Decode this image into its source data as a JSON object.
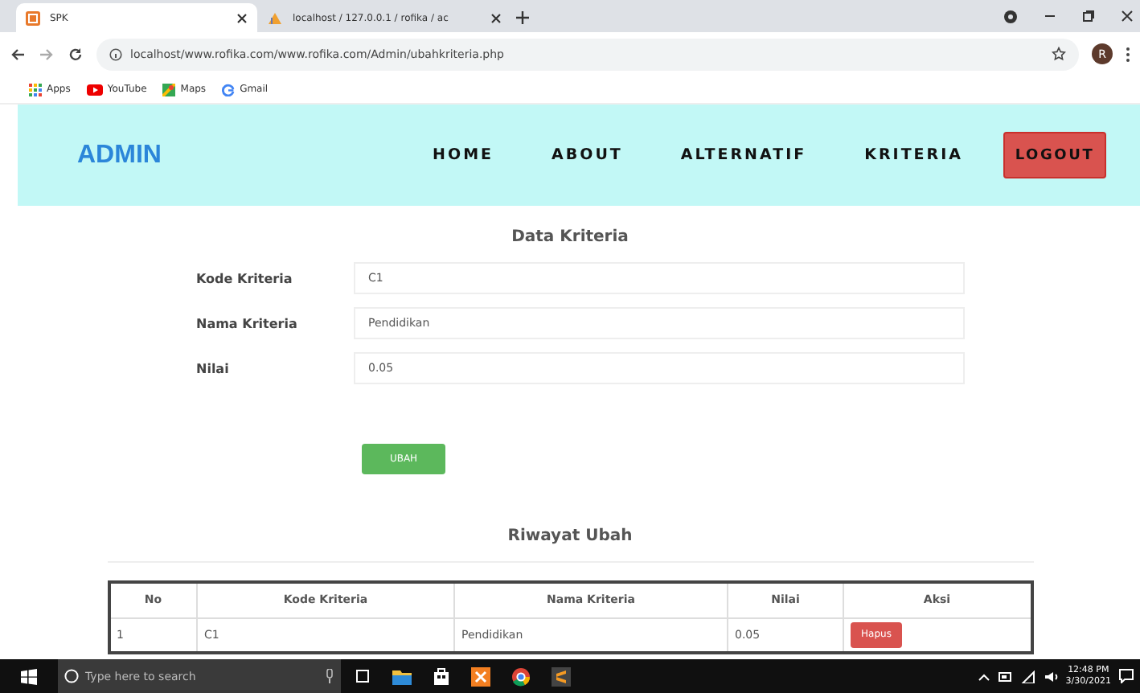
{
  "browser": {
    "tabs": [
      {
        "title": "SPK",
        "selected": true,
        "kind": "spk"
      },
      {
        "title": "localhost / 127.0.0.1 / rofika / ac",
        "selected": false,
        "kind": "pma"
      }
    ],
    "address": "localhost/www.rofika.com/www.rofika.com/Admin/ubahkriteria.php",
    "profile": "R",
    "bookmarks": [
      {
        "label": "Apps",
        "kind": "apps"
      },
      {
        "label": "YouTube",
        "kind": "youtube"
      },
      {
        "label": "Maps",
        "kind": "maps"
      },
      {
        "label": "Gmail",
        "kind": "gmail"
      }
    ]
  },
  "header": {
    "brand": "ADMIN",
    "nav": [
      "HOME",
      "ABOUT",
      "ALTERNATIF",
      "KRITERIA"
    ],
    "logout": "LOGOUT"
  },
  "form": {
    "title": "Data Kriteria",
    "fields": [
      {
        "label": "Kode Kriteria",
        "value": "C1"
      },
      {
        "label": "Nama Kriteria",
        "value": "Pendidikan"
      },
      {
        "label": "Nilai",
        "value": "0.05"
      }
    ],
    "submit": "UBAH"
  },
  "history": {
    "title": "Riwayat Ubah",
    "columns": [
      "No",
      "Kode Kriteria",
      "Nama Kriteria",
      "Nilai",
      "Aksi"
    ],
    "rows": [
      {
        "no": "1",
        "kode": "C1",
        "nama": "Pendidikan",
        "nilai": "0.05",
        "action": "Hapus"
      }
    ]
  },
  "taskbar": {
    "search_placeholder": "Type here to search",
    "time": "12:48 PM",
    "date": "3/30/2021"
  }
}
